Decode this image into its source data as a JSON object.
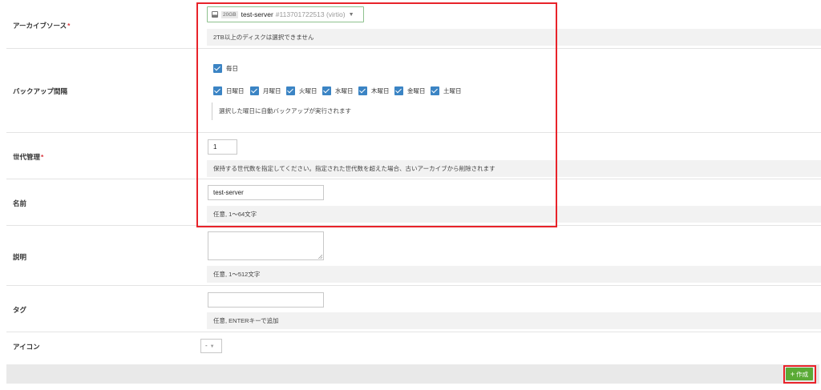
{
  "archive_source": {
    "label": "アーカイブソース",
    "required_mark": "*",
    "disk": {
      "size": "20GB",
      "name": "test-server",
      "id": "#113701722513 (virtio)",
      "caret": "▼"
    },
    "help": "2TB以上のディスクは選択できません"
  },
  "backup_schedule": {
    "label": "バックアップ間隔",
    "daily": {
      "label": "毎日",
      "checked": true
    },
    "days": [
      {
        "label": "日曜日",
        "checked": true
      },
      {
        "label": "月曜日",
        "checked": true
      },
      {
        "label": "火曜日",
        "checked": true
      },
      {
        "label": "水曜日",
        "checked": true
      },
      {
        "label": "木曜日",
        "checked": true
      },
      {
        "label": "金曜日",
        "checked": true
      },
      {
        "label": "土曜日",
        "checked": true
      }
    ],
    "note": "選択した曜日に自動バックアップが実行されます"
  },
  "generations": {
    "label": "世代管理",
    "required_mark": "*",
    "value": "1",
    "help": "保持する世代数を指定してください。指定された世代数を超えた場合、古いアーカイブから削除されます"
  },
  "name": {
    "label": "名前",
    "value": "test-server",
    "help": "任意, 1〜64文字"
  },
  "description": {
    "label": "説明",
    "value": "",
    "help": "任意, 1〜512文字"
  },
  "tags": {
    "label": "タグ",
    "value": "",
    "help": "任意, ENTERキーで追加"
  },
  "icon": {
    "label": "アイコン",
    "value": "-",
    "caret": "▼"
  },
  "create_button": {
    "label": "作成",
    "icon": "plus-icon",
    "color": "#5aaa35"
  },
  "highlight_color": "#e8232a"
}
